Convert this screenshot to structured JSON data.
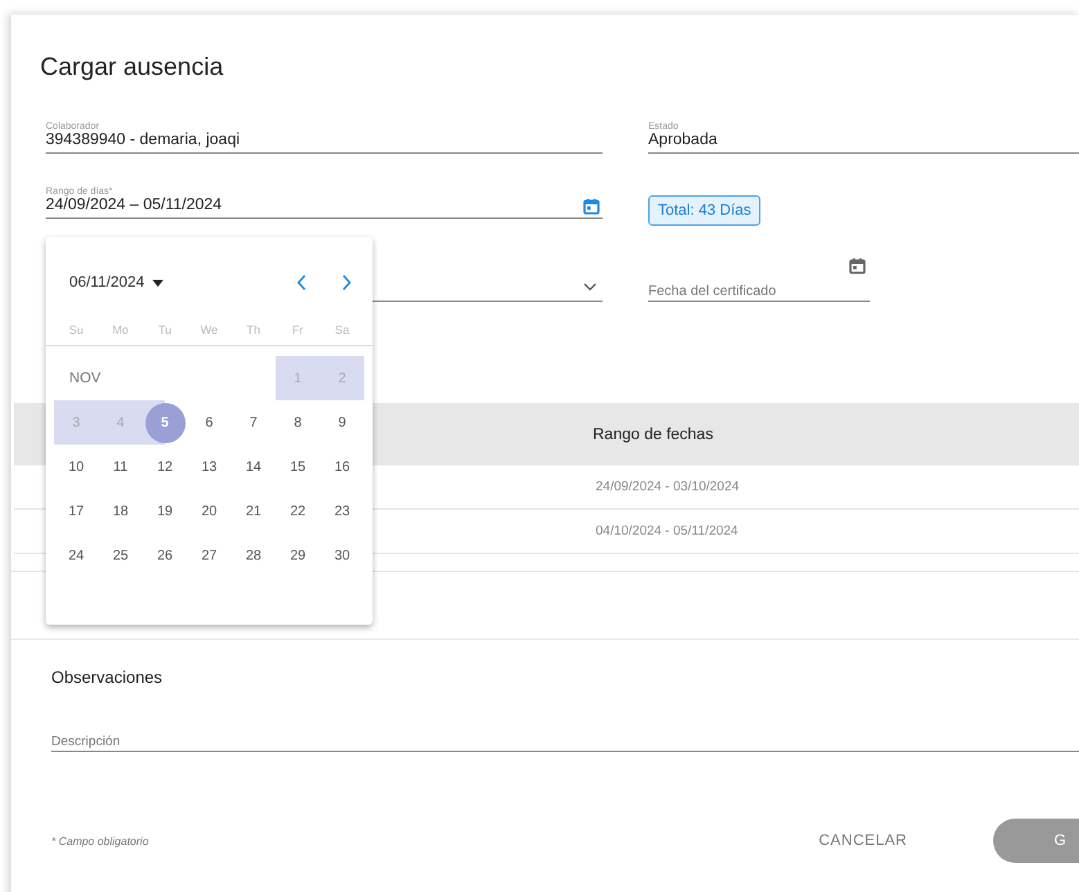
{
  "dialog": {
    "title": "Cargar ausencia"
  },
  "fields": {
    "colaborador": {
      "label": "Colaborador",
      "value": "394389940 - demaria, joaqi"
    },
    "estado": {
      "label": "Estado",
      "value": "Aprobada"
    },
    "rango": {
      "label": "Rango de días*",
      "value": "24/09/2024 – 05/11/2024"
    },
    "total": "Total: 43 Días",
    "certificado": {
      "placeholder": "Fecha del certificado"
    }
  },
  "datepicker": {
    "period": "06/11/2024",
    "month": "NOV",
    "weekdays": [
      "Su",
      "Mo",
      "Tu",
      "We",
      "Th",
      "Fr",
      "Sa"
    ],
    "days": [
      {
        "label": "1",
        "in_range": true,
        "selected": false
      },
      {
        "label": "2",
        "in_range": true,
        "selected": false
      },
      {
        "label": "3",
        "in_range": true,
        "selected": false
      },
      {
        "label": "4",
        "in_range": true,
        "selected": false
      },
      {
        "label": "5",
        "in_range": true,
        "selected": true
      },
      {
        "label": "6",
        "in_range": false,
        "selected": false
      },
      {
        "label": "7",
        "in_range": false,
        "selected": false
      },
      {
        "label": "8",
        "in_range": false,
        "selected": false
      },
      {
        "label": "9",
        "in_range": false,
        "selected": false
      },
      {
        "label": "10",
        "in_range": false,
        "selected": false
      },
      {
        "label": "11",
        "in_range": false,
        "selected": false
      },
      {
        "label": "12",
        "in_range": false,
        "selected": false
      },
      {
        "label": "13",
        "in_range": false,
        "selected": false
      },
      {
        "label": "14",
        "in_range": false,
        "selected": false
      },
      {
        "label": "15",
        "in_range": false,
        "selected": false
      },
      {
        "label": "16",
        "in_range": false,
        "selected": false
      },
      {
        "label": "17",
        "in_range": false,
        "selected": false
      },
      {
        "label": "18",
        "in_range": false,
        "selected": false
      },
      {
        "label": "19",
        "in_range": false,
        "selected": false
      },
      {
        "label": "20",
        "in_range": false,
        "selected": false
      },
      {
        "label": "21",
        "in_range": false,
        "selected": false
      },
      {
        "label": "22",
        "in_range": false,
        "selected": false
      },
      {
        "label": "23",
        "in_range": false,
        "selected": false
      },
      {
        "label": "24",
        "in_range": false,
        "selected": false
      },
      {
        "label": "25",
        "in_range": false,
        "selected": false
      },
      {
        "label": "26",
        "in_range": false,
        "selected": false
      },
      {
        "label": "27",
        "in_range": false,
        "selected": false
      },
      {
        "label": "28",
        "in_range": false,
        "selected": false
      },
      {
        "label": "29",
        "in_range": false,
        "selected": false
      },
      {
        "label": "30",
        "in_range": false,
        "selected": false
      }
    ]
  },
  "table": {
    "columns": [
      "Rango de fechas"
    ],
    "rows": [
      "24/09/2024 - 03/10/2024",
      "04/10/2024 - 05/11/2024"
    ]
  },
  "observaciones": {
    "title": "Observaciones",
    "placeholder": "Descripción"
  },
  "footer": {
    "note": "* Campo obligatorio",
    "buttons": [
      "CANCELAR",
      "G"
    ]
  }
}
